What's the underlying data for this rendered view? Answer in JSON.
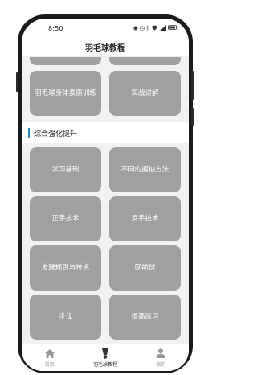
{
  "status_bar": {
    "time": "8:50",
    "icons": [
      "eye-icon",
      "alarm-icon",
      "bluetooth-icon",
      "wifi-icon",
      "signal-icon",
      "battery-icon"
    ]
  },
  "header": {
    "title": "羽毛球教程"
  },
  "top_tiles": [
    {
      "label": ""
    },
    {
      "label": ""
    },
    {
      "label": "羽毛球身体素质训练"
    },
    {
      "label": "实战讲解"
    }
  ],
  "section": {
    "title": "综合强化提升",
    "accent_color": "#1e88e5"
  },
  "tiles": [
    {
      "label": "学习基础"
    },
    {
      "label": "不同的握拍方法"
    },
    {
      "label": "正手技术"
    },
    {
      "label": "反手技术"
    },
    {
      "label": "发球规则与技术"
    },
    {
      "label": "网前球"
    },
    {
      "label": "步伐"
    },
    {
      "label": "提高练习"
    }
  ],
  "tab_bar": {
    "items": [
      {
        "label": "首页",
        "icon": "home-icon",
        "active": false
      },
      {
        "label": "羽毛球教程",
        "icon": "shuttlecock-icon",
        "active": true
      },
      {
        "label": "我的",
        "icon": "user-icon",
        "active": false
      }
    ]
  },
  "colors": {
    "tile": "#a0a0a0",
    "background": "#f1f1f3",
    "frame": "#1b1b1e"
  }
}
